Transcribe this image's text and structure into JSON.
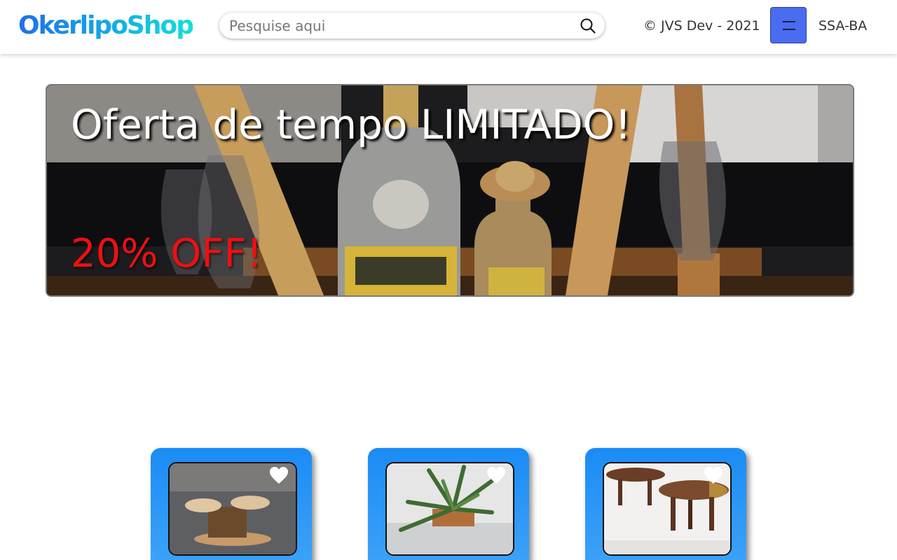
{
  "header": {
    "logo": "OkerlipoShop",
    "search_placeholder": "Pesquise aqui",
    "copyright": "© JVS Dev - 2021",
    "region": "SSA-BA"
  },
  "banner": {
    "title": "Oferta de tempo LIMITADO!",
    "discount": "20% OFF!"
  },
  "products": [
    {
      "image": "wooden-spool-tables-photo"
    },
    {
      "image": "plant-in-wooden-planter-photo"
    },
    {
      "image": "wooden-stools-photo"
    }
  ],
  "colors": {
    "accent": "#4a6cf0",
    "card": "#1a8cf5",
    "discount": "#ee1010"
  }
}
